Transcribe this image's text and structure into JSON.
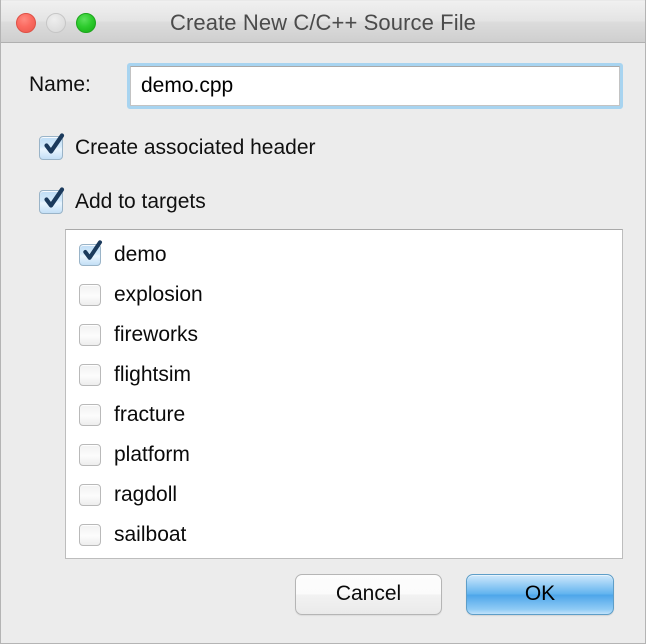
{
  "window": {
    "title": "Create New C/C++ Source File",
    "traffic_lights": [
      {
        "name": "close",
        "color": "#fb6a60",
        "enabled": true
      },
      {
        "name": "minimize",
        "color": "#e2e2e2",
        "enabled": false
      },
      {
        "name": "zoom",
        "color": "#2ecc2e",
        "enabled": true
      }
    ]
  },
  "form": {
    "name_label": "Name:",
    "name_value": "demo.cpp",
    "name_placeholder": "",
    "checkboxes": [
      {
        "label": "Create associated header",
        "checked": true
      },
      {
        "label": "Add to targets",
        "checked": true
      }
    ]
  },
  "targets_list": {
    "items": [
      {
        "label": "demo",
        "checked": true
      },
      {
        "label": "explosion",
        "checked": false
      },
      {
        "label": "fireworks",
        "checked": false
      },
      {
        "label": "flightsim",
        "checked": false
      },
      {
        "label": "fracture",
        "checked": false
      },
      {
        "label": "platform",
        "checked": false
      },
      {
        "label": "ragdoll",
        "checked": false
      },
      {
        "label": "sailboat",
        "checked": false
      }
    ]
  },
  "buttons": {
    "cancel_label": "Cancel",
    "ok_label": "OK",
    "default_button": "OK"
  },
  "colors": {
    "window_background": "#ececec",
    "titlebar_top": "#f0f0f0",
    "titlebar_bottom": "#cfcfcf",
    "focus_ring": "#a8d4f0",
    "default_button_blue": "#63b4ef",
    "checkbox_checked_fill": "#cfe6f9",
    "checkmark": "#1b3a5c",
    "list_background": "#ffffff"
  }
}
